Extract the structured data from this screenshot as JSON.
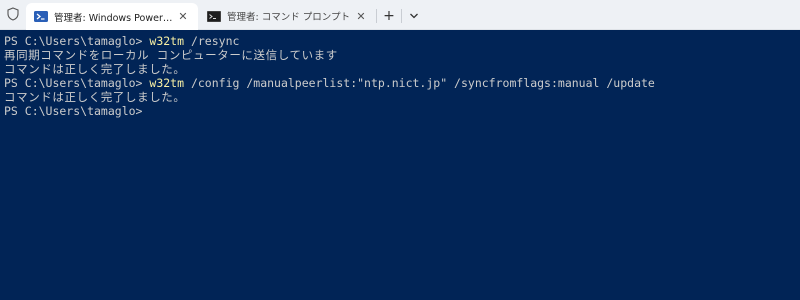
{
  "tabs": [
    {
      "title": "管理者: Windows PowerShell",
      "icon": "powershell-icon",
      "active": true
    },
    {
      "title": "管理者: コマンド プロンプト",
      "icon": "cmd-icon",
      "active": false
    }
  ],
  "toolbar": {
    "new_tab_label": "+",
    "dropdown_label": "⌄"
  },
  "terminal": {
    "lines": [
      {
        "prompt": "PS C:\\Users\\tamaglo> ",
        "command": "w32tm",
        "args": " /resync"
      },
      {
        "output": "再同期コマンドをローカル コンピューターに送信しています"
      },
      {
        "output": "コマンドは正しく完了しました。"
      },
      {
        "prompt": "PS C:\\Users\\tamaglo> ",
        "command": "w32tm",
        "args": " /config /manualpeerlist:\"ntp.nict.jp\" /syncfromflags:manual /update"
      },
      {
        "output": "コマンドは正しく完了しました。"
      },
      {
        "prompt": "PS C:\\Users\\tamaglo>",
        "command": "",
        "args": ""
      }
    ]
  },
  "colors": {
    "terminal_bg": "#012456",
    "command_name": "#f9f1a5",
    "text": "#cccccc"
  }
}
